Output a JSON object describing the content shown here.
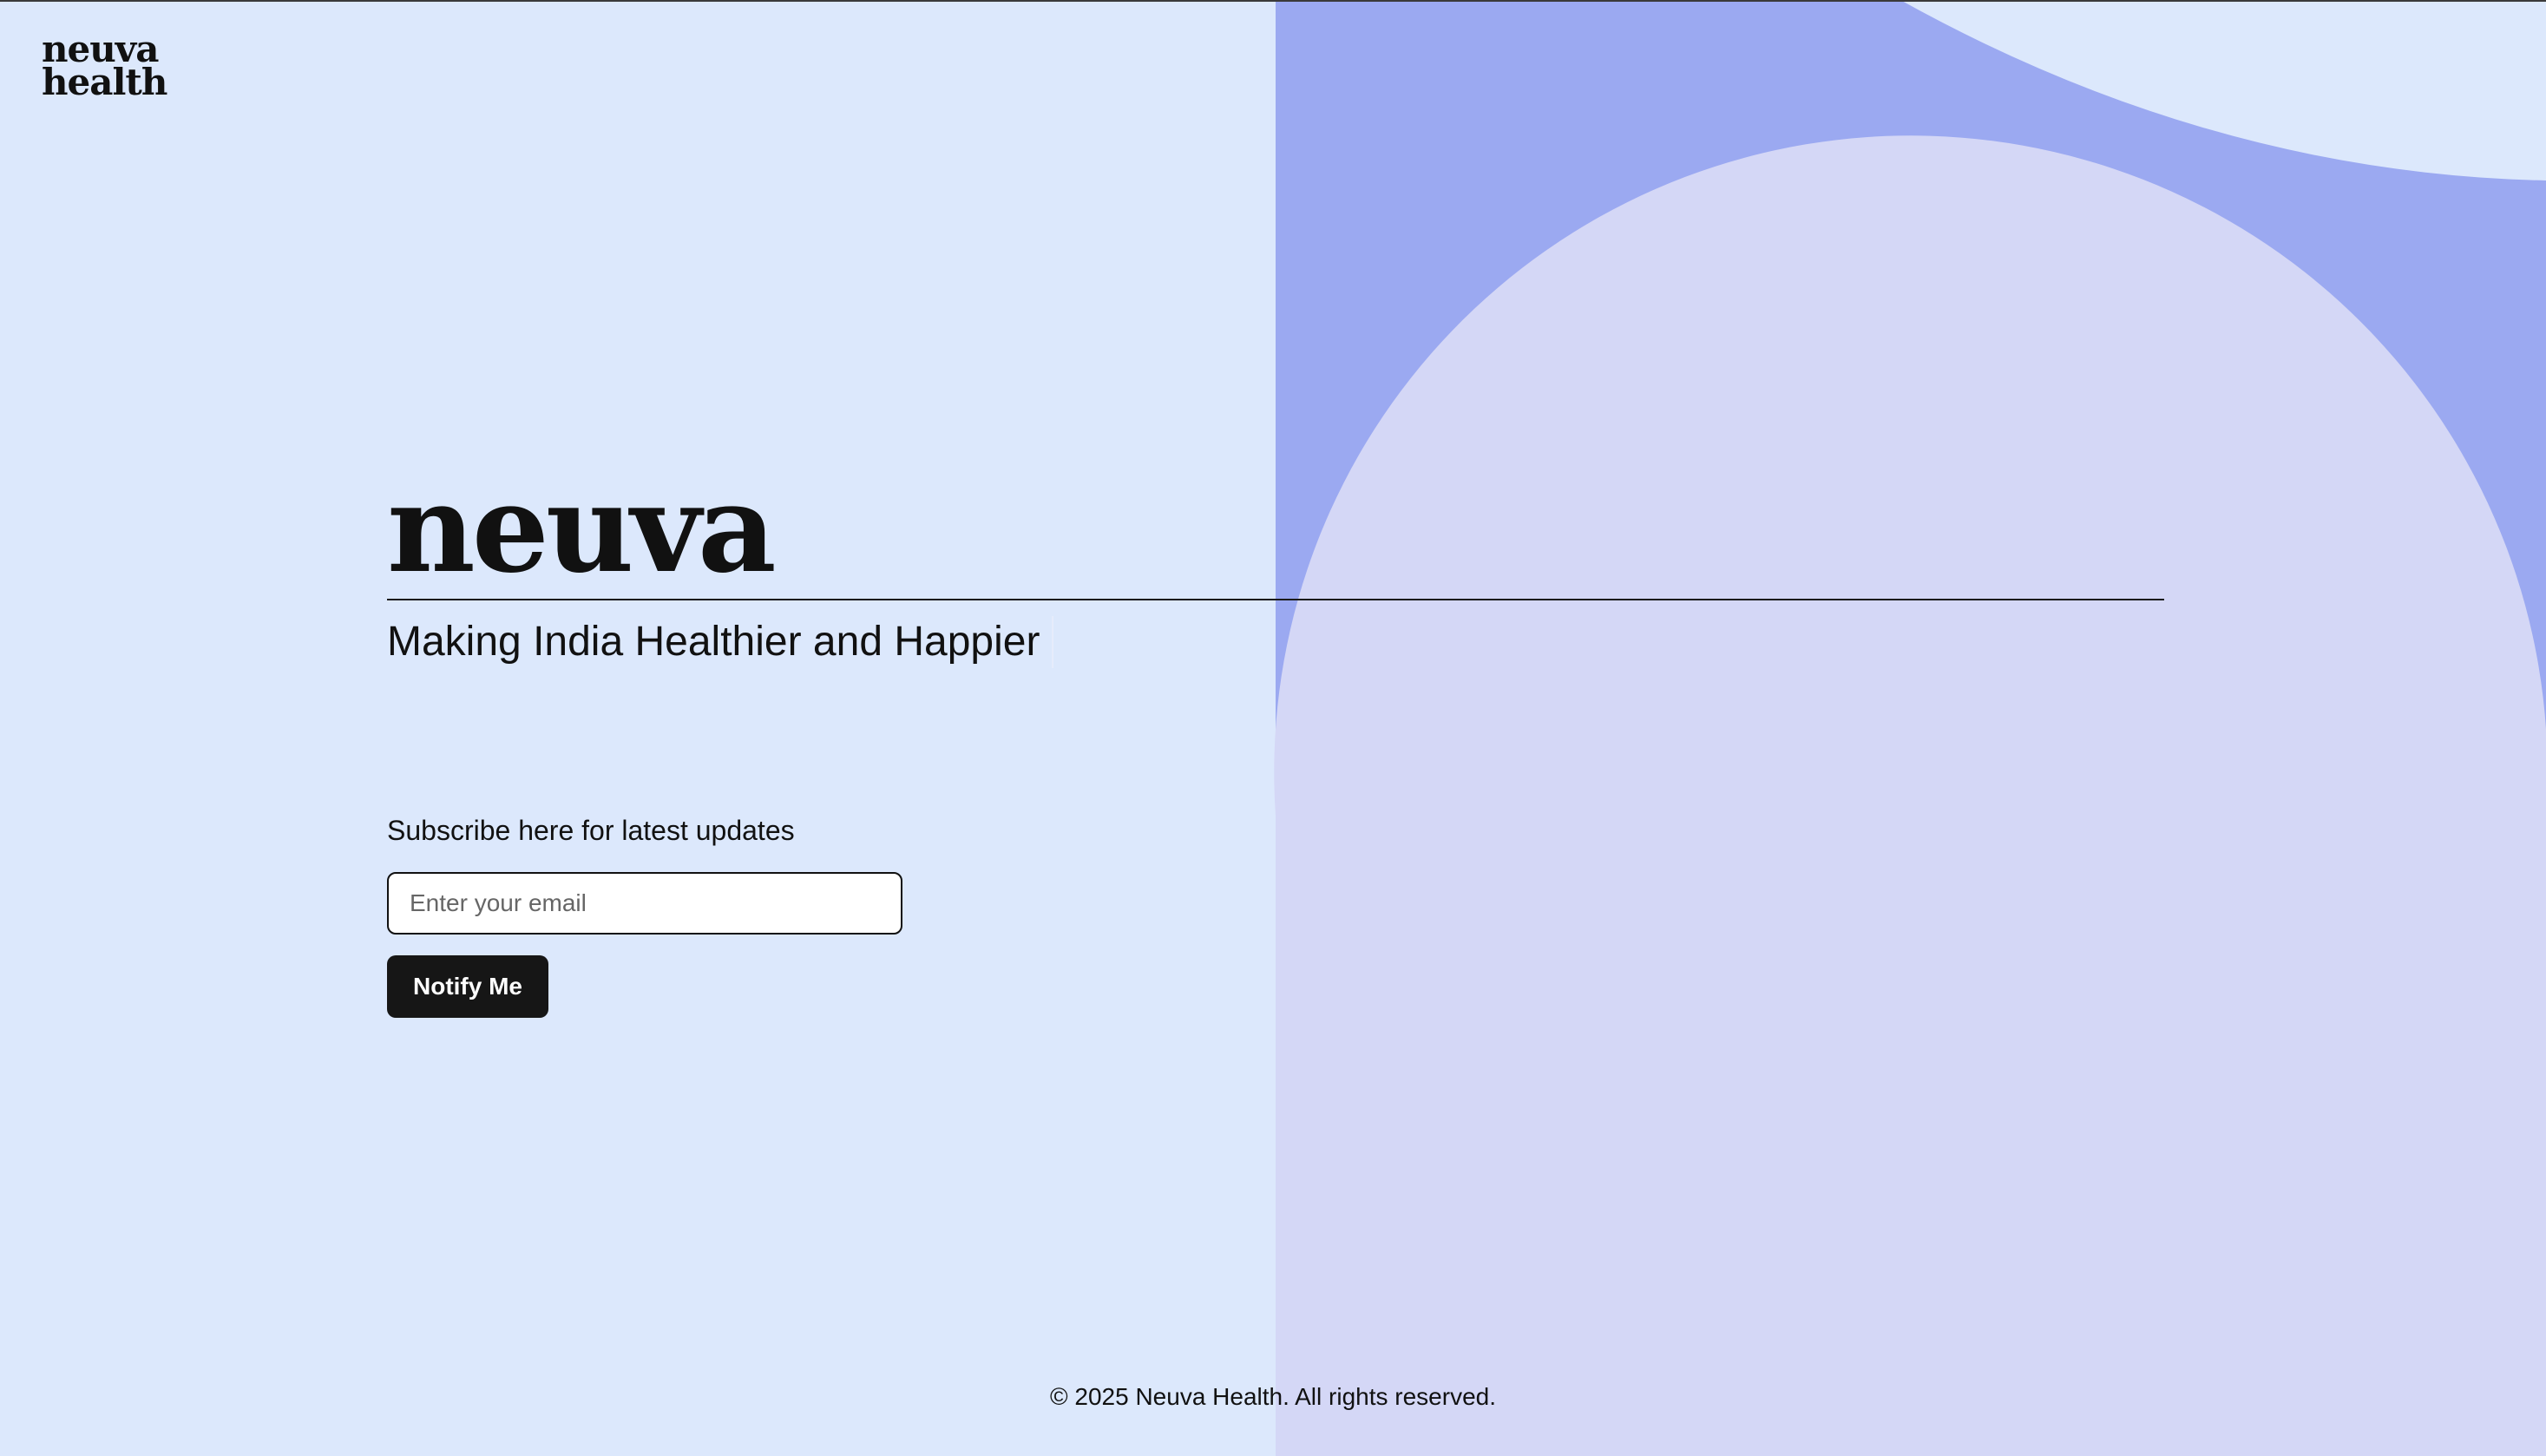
{
  "header": {
    "logo_line1": "neuva",
    "logo_line2": "health"
  },
  "hero": {
    "brand": "neuva",
    "tagline": "Making India Healthier and Happier"
  },
  "subscribe": {
    "label": "Subscribe here for latest updates",
    "email_placeholder": "Enter your email",
    "email_value": "",
    "button_label": "Notify Me"
  },
  "footer": {
    "copyright": "© 2025 Neuva Health. All rights reserved."
  },
  "colors": {
    "background_light": "#dce8fc",
    "shape_periwinkle": "#9ba9f1",
    "shape_lavender": "#d4d7f6",
    "text_dark": "#111111",
    "button_bg": "#161616",
    "button_text": "#ffffff"
  }
}
